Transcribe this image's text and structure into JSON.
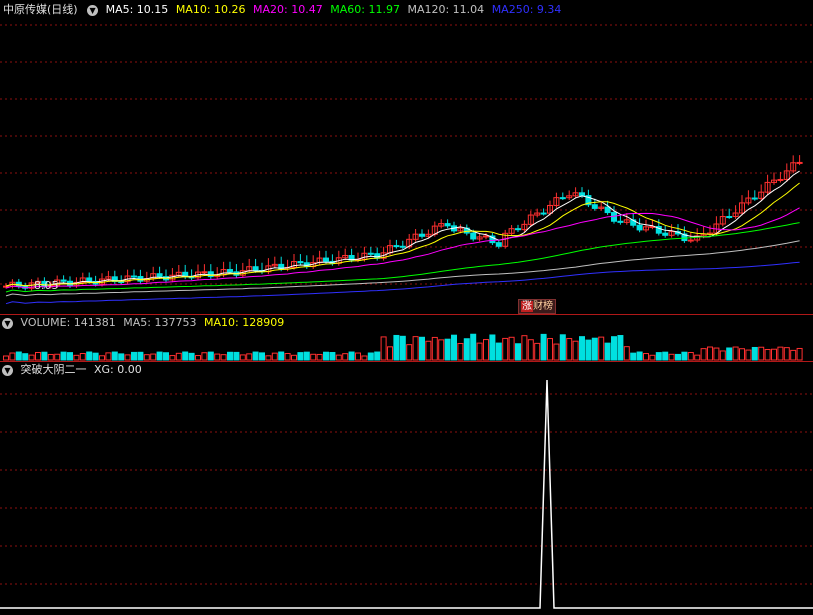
{
  "main": {
    "title": "中原传媒(日线)",
    "ma": [
      {
        "label": "MA5: 10.15",
        "color": "#ffffff"
      },
      {
        "label": "MA10: 10.26",
        "color": "#ffff00"
      },
      {
        "label": "MA20: 10.47",
        "color": "#ff00ff"
      },
      {
        "label": "MA60: 11.97",
        "color": "#00ff00"
      },
      {
        "label": "MA120: 11.04",
        "color": "#c0c0c0"
      },
      {
        "label": "MA250: 9.34",
        "color": "#3030ff"
      }
    ],
    "low_label": "8.05",
    "badge_label": "涨",
    "badge_label2": "财榜"
  },
  "volume": {
    "legend": [
      {
        "label": "VOLUME: 141381",
        "color": "#c0c0c0"
      },
      {
        "label": "MA5: 137753",
        "color": "#c0c0c0"
      },
      {
        "label": "MA10: 128909",
        "color": "#ffff00"
      }
    ]
  },
  "indicator": {
    "name": "突破大阴二一",
    "xg_label": "XG: 0.00"
  },
  "colors": {
    "up": "#ff3030",
    "down": "#00e0e0",
    "grid": "#8b1010",
    "ma5": "#ffffff",
    "ma10": "#ffff00",
    "ma20": "#ff00ff",
    "ma60": "#00ff00",
    "ma120": "#c0c0c0",
    "ma250": "#3030ff"
  }
}
